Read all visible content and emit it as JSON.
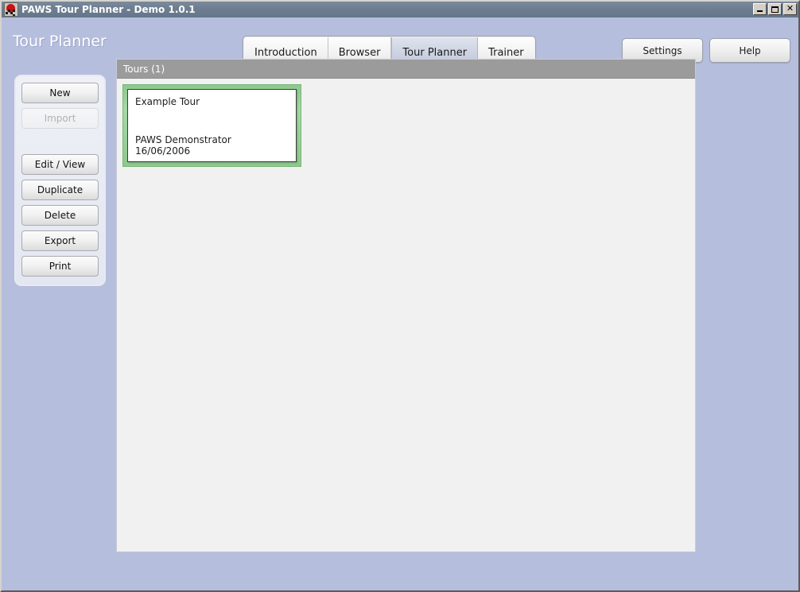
{
  "window": {
    "title": "PAWS Tour Planner - Demo 1.0.1",
    "icon": "paws-flag-icon",
    "buttons": {
      "minimize": "Minimize",
      "maximize": "Maximize",
      "close": "Close"
    }
  },
  "header": {
    "page_title": "Tour Planner",
    "tabs": [
      {
        "label": "Introduction",
        "selected": false
      },
      {
        "label": "Browser",
        "selected": false
      },
      {
        "label": "Tour Planner",
        "selected": true
      },
      {
        "label": "Trainer",
        "selected": false
      }
    ],
    "actions": [
      {
        "label": "Settings"
      },
      {
        "label": "Help"
      }
    ]
  },
  "sidebar": {
    "buttons": [
      {
        "label": "New",
        "disabled": false
      },
      {
        "label": "Import",
        "disabled": true
      },
      {
        "label": "Edit / View",
        "disabled": false
      },
      {
        "label": "Duplicate",
        "disabled": false
      },
      {
        "label": "Delete",
        "disabled": false
      },
      {
        "label": "Export",
        "disabled": false
      },
      {
        "label": "Print",
        "disabled": false
      }
    ]
  },
  "main": {
    "panel_header": "Tours (1)",
    "tours": [
      {
        "name": "Example Tour",
        "author": "PAWS Demonstrator",
        "date": "16/06/2006",
        "selected": true
      }
    ]
  },
  "colors": {
    "background": "#b6bedd",
    "titlebar": "#6d7e90",
    "panel_header": "#9b9b9b",
    "selection_green": "#8ec98e",
    "panel_body": "#f1f1f1"
  }
}
